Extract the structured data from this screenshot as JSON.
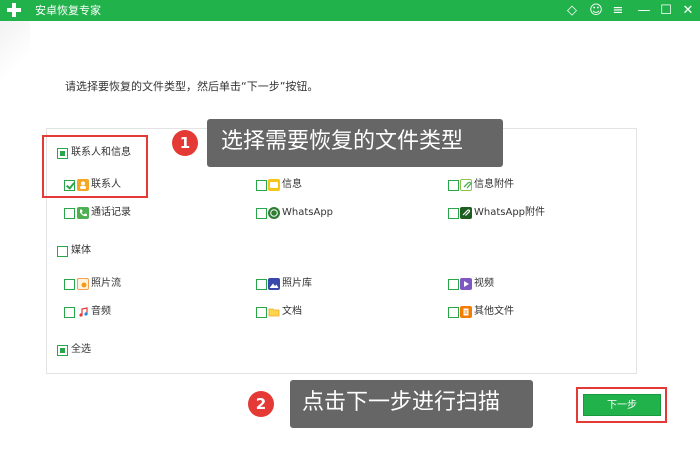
{
  "app": {
    "title": "安卓恢复专家"
  },
  "titlebar_buttons": [
    {
      "name": "diamond-icon",
      "glyph": "◇"
    },
    {
      "name": "chat-icon",
      "glyph": "☺"
    },
    {
      "name": "menu-icon",
      "glyph": "≡"
    },
    {
      "name": "minimize-icon",
      "glyph": "—"
    },
    {
      "name": "maximize-icon",
      "glyph": "☐"
    },
    {
      "name": "close-icon",
      "glyph": "✕"
    }
  ],
  "instruction": "请选择要恢复的文件类型，然后单击“下一步”按钮。",
  "groups": {
    "contacts": {
      "label": "联系人和信息",
      "items": {
        "contacts": "联系人",
        "messages": "信息",
        "message_attachments": "信息附件",
        "call_log": "通话记录",
        "whatsapp": "WhatsApp",
        "whatsapp_attachments": "WhatsApp附件"
      }
    },
    "media": {
      "label": "媒体",
      "items": {
        "photo_stream": "照片流",
        "photo_library": "照片库",
        "video": "视频",
        "audio": "音频",
        "documents": "文档",
        "other_files": "其他文件"
      }
    },
    "select_all": "全选"
  },
  "callouts": {
    "step1": {
      "number": "1",
      "text": "选择需要恢复的文件类型"
    },
    "step2": {
      "number": "2",
      "text": "点击下一步进行扫描"
    }
  },
  "next_button": "下一步",
  "colors": {
    "brand": "#21b24b",
    "highlight": "#e53935",
    "callout_bg": "#666666"
  }
}
